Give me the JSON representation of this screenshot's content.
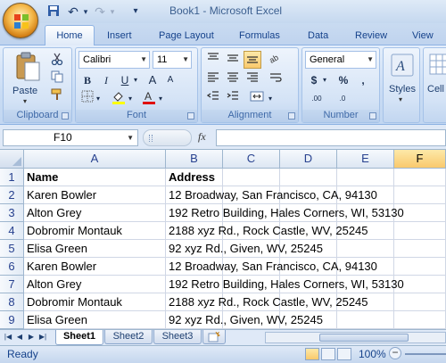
{
  "window": {
    "title": "Book1 - Microsoft Excel"
  },
  "qat": {
    "undo": "↶",
    "redo": "↷",
    "customize": "▾"
  },
  "tabs": [
    "Home",
    "Insert",
    "Page Layout",
    "Formulas",
    "Data",
    "Review",
    "View"
  ],
  "ribbon": {
    "clipboard": {
      "label": "Clipboard",
      "paste_label": "Paste"
    },
    "font": {
      "label": "Font",
      "name": "Calibri",
      "size": "11",
      "bold": "B",
      "italic": "I",
      "underline": "U",
      "grow": "A",
      "shrink": "A"
    },
    "alignment": {
      "label": "Alignment"
    },
    "number": {
      "label": "Number",
      "format": "General",
      "currency": "$",
      "percent": "%",
      "comma": ",",
      "inc_decimal": ".00",
      "dec_decimal": ".0"
    },
    "styles": {
      "label": "Styles"
    },
    "cells": {
      "label": "Cell"
    }
  },
  "formula_bar": {
    "name_box": "F10",
    "fx": "fx",
    "value": ""
  },
  "grid": {
    "columns": [
      "A",
      "B",
      "C",
      "D",
      "E",
      "F"
    ],
    "selected_column": "F",
    "rows": [
      {
        "num": "1",
        "a": "Name",
        "b": "Address"
      },
      {
        "num": "2",
        "a": "Karen Bowler",
        "b": "12 Broadway, San Francisco, CA, 94130"
      },
      {
        "num": "3",
        "a": "Alton Grey",
        "b": "192 Retro Building, Hales Corners, WI, 53130"
      },
      {
        "num": "4",
        "a": "Dobromir Montauk",
        "b": "2188 xyz Rd., Rock Castle, WV, 25245"
      },
      {
        "num": "5",
        "a": "Elisa Green",
        "b": "92 xyz Rd., Given, WV, 25245"
      },
      {
        "num": "6",
        "a": "Karen Bowler",
        "b": "12 Broadway, San Francisco, CA, 94130"
      },
      {
        "num": "7",
        "a": "Alton Grey",
        "b": "192 Retro Building, Hales Corners, WI, 53130"
      },
      {
        "num": "8",
        "a": "Dobromir Montauk",
        "b": "2188 xyz Rd., Rock Castle, WV, 25245"
      },
      {
        "num": "9",
        "a": "Elisa Green",
        "b": "92 xyz Rd., Given, WV, 25245"
      }
    ]
  },
  "sheets": [
    "Sheet1",
    "Sheet2",
    "Sheet3"
  ],
  "active_sheet": "Sheet1",
  "status": {
    "ready": "Ready",
    "zoom": "100%"
  },
  "colors": {
    "accent": "#15428b",
    "selection": "#f9c96c"
  }
}
